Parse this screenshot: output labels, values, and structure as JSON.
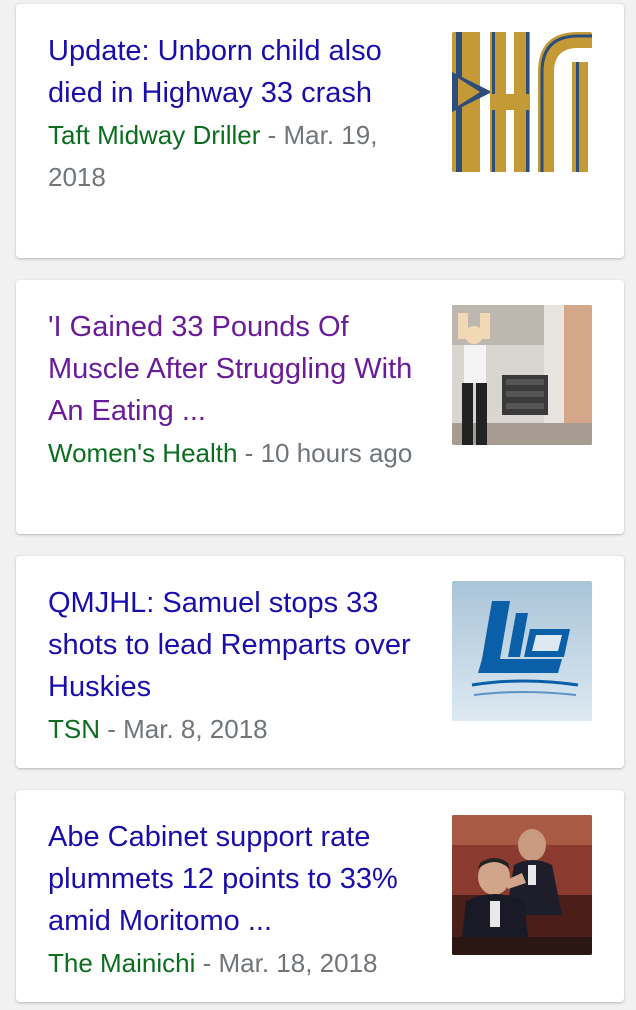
{
  "articles": [
    {
      "headline": "Update: Unborn child also died in Highway 33 crash",
      "source": "Taft Midway Driller",
      "separator": " - ",
      "date": "Mar. 19, 2018",
      "thumbnail_icon": "newspaper-logo-icon",
      "visited": false
    },
    {
      "headline": "'I Gained 33 Pounds Of Muscle After Struggling With An Eating ...",
      "source": "Women's Health",
      "separator": " - ",
      "date": "10 hours ago",
      "thumbnail_icon": "gym-photo-icon",
      "visited": true
    },
    {
      "headline": "QMJHL: Samuel stops 33 shots to lead Remparts over Huskies",
      "source": "TSN",
      "separator": " - ",
      "date": "Mar. 8, 2018",
      "thumbnail_icon": "lhjmq-logo-icon",
      "visited": false
    },
    {
      "headline": "Abe Cabinet support rate plummets 12 points to 33% amid Moritomo ...",
      "source": "The Mainichi",
      "separator": " - ",
      "date": "Mar. 18, 2018",
      "thumbnail_icon": "politician-photo-icon",
      "visited": false
    }
  ],
  "colors": {
    "link": "#1a0dab",
    "visited_link": "#6a1b9a",
    "source": "#0b6e1f",
    "meta": "#70757a",
    "background": "#f1f1f1"
  }
}
